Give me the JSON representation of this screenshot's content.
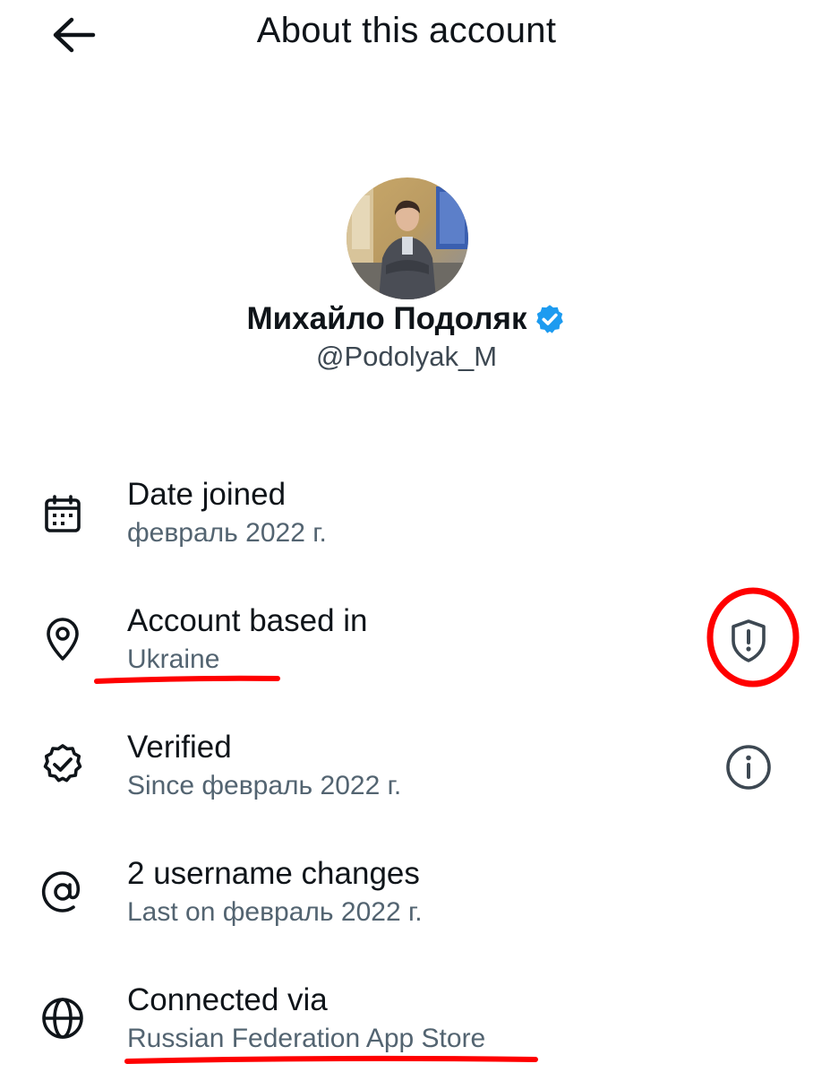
{
  "header": {
    "back_icon": "arrow-left-icon",
    "title": "About this account"
  },
  "profile": {
    "display_name": "Михайло Подоляк",
    "verified_icon": "verified-badge-icon",
    "handle": "@Podolyak_M"
  },
  "rows": [
    {
      "icon": "calendar-icon",
      "title": "Date joined",
      "subtitle": "февраль 2022 г."
    },
    {
      "icon": "location-pin-icon",
      "title": "Account based in",
      "subtitle": "Ukraine",
      "action_icon": "shield-alert-icon"
    },
    {
      "icon": "verified-outline-icon",
      "title": "Verified",
      "subtitle": "Since февраль 2022 г.",
      "action_icon": "info-icon"
    },
    {
      "icon": "at-sign-icon",
      "title": "2 username changes",
      "subtitle": "Last on февраль 2022 г."
    },
    {
      "icon": "globe-icon",
      "title": "Connected via",
      "subtitle": "Russian Federation App Store"
    }
  ],
  "colors": {
    "text_primary": "#0f1419",
    "text_secondary": "#536471",
    "verified_blue": "#1d9bf0",
    "annotation_red": "#ff0000"
  }
}
